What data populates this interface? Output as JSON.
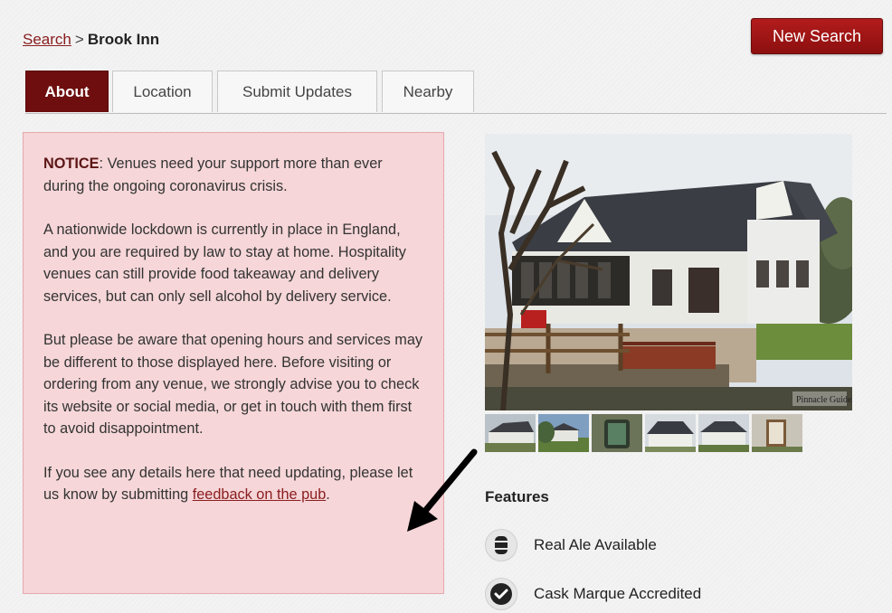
{
  "breadcrumb": {
    "link": "Search",
    "separator": ">",
    "current": "Brook Inn"
  },
  "header": {
    "new_search_label": "New Search"
  },
  "tabs": [
    {
      "label": "About",
      "active": true
    },
    {
      "label": "Location",
      "active": false
    },
    {
      "label": "Submit Updates",
      "active": false
    },
    {
      "label": "Nearby",
      "active": false
    }
  ],
  "notice": {
    "heading": "NOTICE",
    "intro": ": Venues need your support more than ever during the ongoing coronavirus crisis.",
    "para2": "A nationwide lockdown is currently in place in England, and you are required by law to stay at home. Hospitality venues can still provide food takeaway and delivery services, but can only sell alcohol by delivery service.",
    "para3": "But please be aware that opening hours and services may be different to those displayed here. Before visiting or ordering from any venue, we strongly advise you to check its website or social media, or get in touch with them first to avoid disappointment.",
    "para4_prefix": "If you see any details here that need updating, please let us know by submitting ",
    "para4_link": "feedback on the pub",
    "para4_suffix": "."
  },
  "photo": {
    "credit": "Pinnacle Guides"
  },
  "features": {
    "title": "Features",
    "items": [
      {
        "label": "Real Ale Available",
        "icon": "beer-barrel-icon"
      },
      {
        "label": "Cask Marque Accredited",
        "icon": "checkmark-icon"
      }
    ]
  },
  "colors": {
    "brand": "#8d0f0f",
    "tab_active": "#6e0e0e",
    "notice_bg": "#f6d6d8",
    "link": "#8a1e20"
  }
}
